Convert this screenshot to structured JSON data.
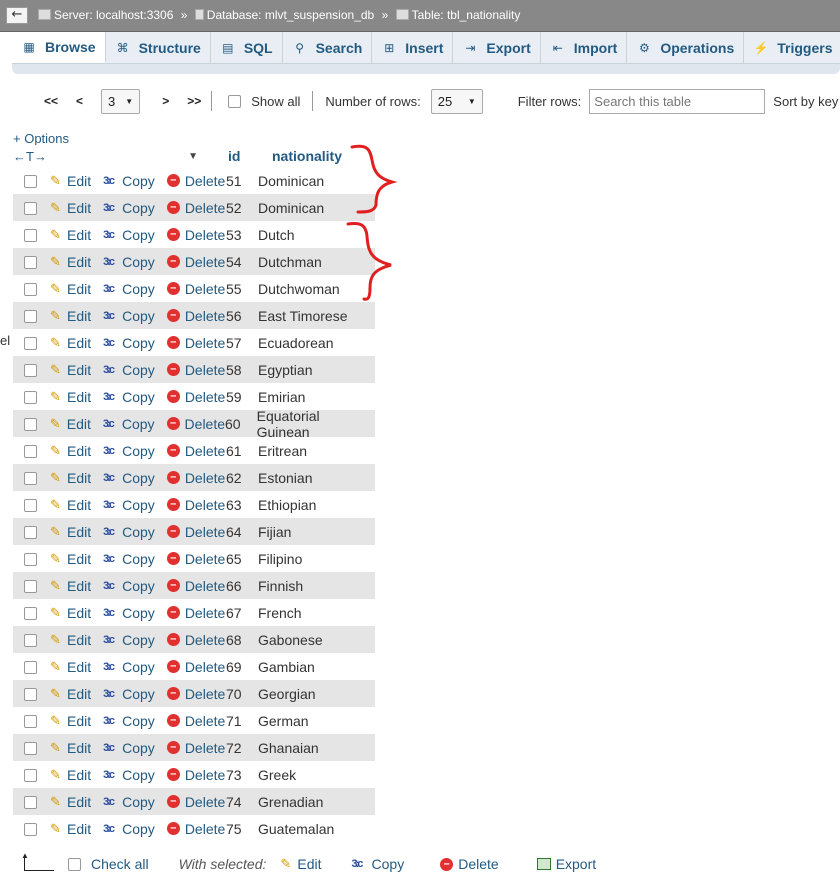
{
  "breadcrumb": {
    "server": "Server: localhost:3306",
    "database": "Database: mlvt_suspension_db",
    "table": "Table: tbl_nationality",
    "separator": "»"
  },
  "tabs": [
    {
      "label": "Browse",
      "icon": "browse-icon"
    },
    {
      "label": "Structure",
      "icon": "structure-icon"
    },
    {
      "label": "SQL",
      "icon": "sql-icon"
    },
    {
      "label": "Search",
      "icon": "search-icon"
    },
    {
      "label": "Insert",
      "icon": "insert-icon"
    },
    {
      "label": "Export",
      "icon": "export-icon"
    },
    {
      "label": "Import",
      "icon": "import-icon"
    },
    {
      "label": "Operations",
      "icon": "operations-icon"
    },
    {
      "label": "Triggers",
      "icon": "triggers-icon"
    }
  ],
  "nav": {
    "first": "<<",
    "prev": "<",
    "page": "3",
    "next": ">",
    "last": ">>",
    "show_all": "Show all",
    "rows_label": "Number of rows:",
    "rows_value": "25",
    "filter_label": "Filter rows:",
    "filter_placeholder": "Search this table",
    "sort_label": "Sort by key"
  },
  "options_link": "+ Options",
  "columns": {
    "id": "id",
    "nationality": "nationality"
  },
  "actions": {
    "edit": "Edit",
    "copy": "Copy",
    "delete": "Delete"
  },
  "rows": [
    {
      "id": "51",
      "nationality": "Dominican"
    },
    {
      "id": "52",
      "nationality": "Dominican"
    },
    {
      "id": "53",
      "nationality": "Dutch"
    },
    {
      "id": "54",
      "nationality": "Dutchman"
    },
    {
      "id": "55",
      "nationality": "Dutchwoman"
    },
    {
      "id": "56",
      "nationality": "East Timorese"
    },
    {
      "id": "57",
      "nationality": "Ecuadorean"
    },
    {
      "id": "58",
      "nationality": "Egyptian"
    },
    {
      "id": "59",
      "nationality": "Emirian"
    },
    {
      "id": "60",
      "nationality": "Equatorial Guinean"
    },
    {
      "id": "61",
      "nationality": "Eritrean"
    },
    {
      "id": "62",
      "nationality": "Estonian"
    },
    {
      "id": "63",
      "nationality": "Ethiopian"
    },
    {
      "id": "64",
      "nationality": "Fijian"
    },
    {
      "id": "65",
      "nationality": "Filipino"
    },
    {
      "id": "66",
      "nationality": "Finnish"
    },
    {
      "id": "67",
      "nationality": "French"
    },
    {
      "id": "68",
      "nationality": "Gabonese"
    },
    {
      "id": "69",
      "nationality": "Gambian"
    },
    {
      "id": "70",
      "nationality": "Georgian"
    },
    {
      "id": "71",
      "nationality": "German"
    },
    {
      "id": "72",
      "nationality": "Ghanaian"
    },
    {
      "id": "73",
      "nationality": "Greek"
    },
    {
      "id": "74",
      "nationality": "Grenadian"
    },
    {
      "id": "75",
      "nationality": "Guatemalan"
    }
  ],
  "bottom": {
    "check_all": "Check all",
    "with_selected": "With selected:",
    "edit": "Edit",
    "copy": "Copy",
    "delete": "Delete",
    "export": "Export"
  },
  "left_fragment": "el",
  "colors": {
    "link": "#235a81",
    "row_even": "#e5e5e5",
    "annotation": "#e02020"
  }
}
